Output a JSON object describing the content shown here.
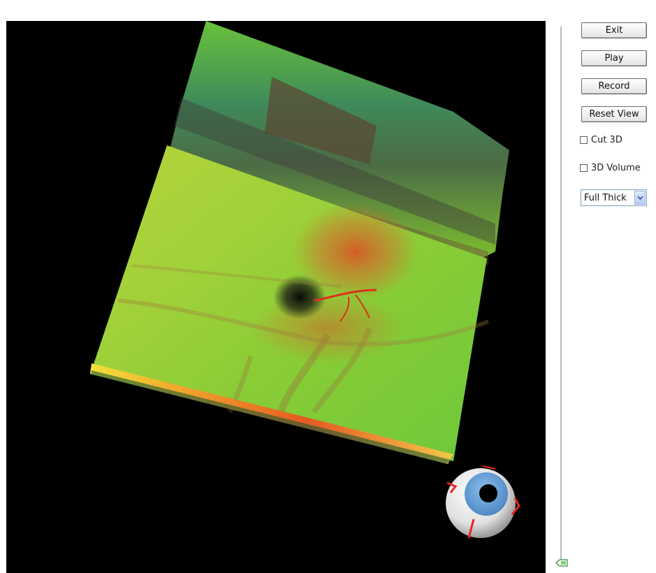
{
  "controls": {
    "exit_label": "Exit",
    "play_label": "Play",
    "record_label": "Record",
    "reset_view_label": "Reset View",
    "cut3d_label": "Cut 3D",
    "volume3d_label": "3D Volume",
    "layer_select_value": "Full Thick"
  },
  "viewport": {
    "background": "#000000",
    "surface_color": "#7ed23a",
    "highlight_color": "#d0582a"
  },
  "orientation_widget": {
    "icon": "eyeball-icon",
    "iris_color": "#5f9fd6",
    "marker_color": "#e8241e"
  },
  "slider": {
    "icon": "slider-thumb-icon"
  }
}
